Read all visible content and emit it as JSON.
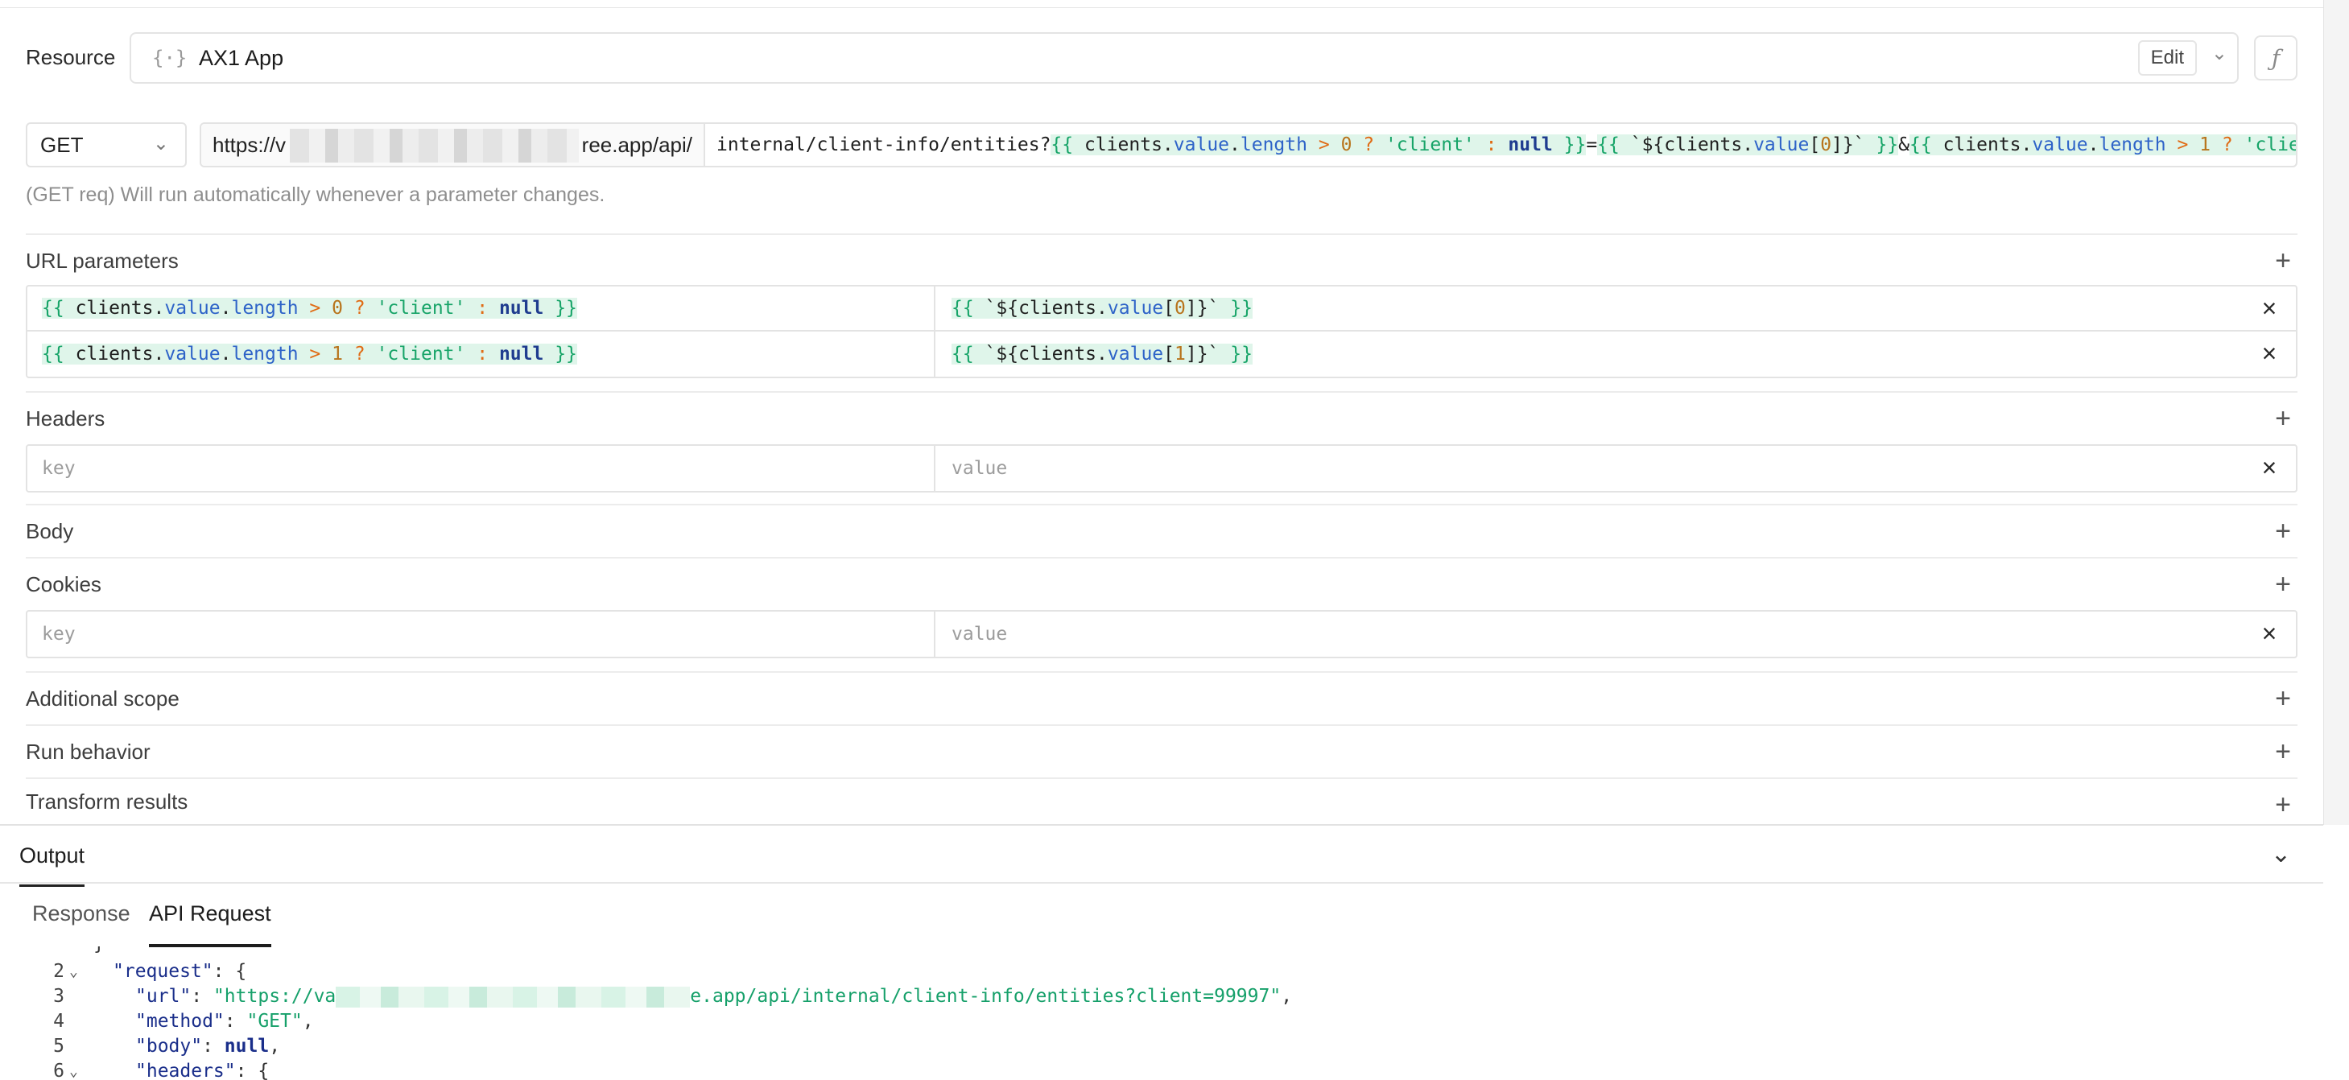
{
  "resource": {
    "label": "Resource",
    "icon": "braces-icon",
    "name": "AX1 App",
    "edit_label": "Edit",
    "fx_label": "ƒ"
  },
  "request": {
    "method": "GET",
    "base_url_prefix": "https://v",
    "base_url_suffix": "ree.app/api/",
    "hint": "(GET req) Will run automatically whenever a parameter changes."
  },
  "sections": {
    "url_parameters": "URL parameters",
    "headers": "Headers",
    "body": "Body",
    "cookies": "Cookies",
    "additional_scope": "Additional scope",
    "run_behavior": "Run behavior",
    "transform_results": "Transform results"
  },
  "placeholders": {
    "key": "key",
    "value": "value"
  },
  "output": {
    "title": "Output",
    "tabs": [
      "Response",
      "API Request"
    ],
    "active_tab": "API Request"
  },
  "code": {
    "line_numbers": [
      "2",
      "3",
      "4",
      "5",
      "6"
    ],
    "request_key": "\"request\"",
    "url_key": "\"url\"",
    "url_prefix": "\"https://va",
    "url_suffix": "e.app/api/internal/client-info/entities?client=99997\"",
    "method_key": "\"method\"",
    "method_val": "\"GET\"",
    "body_key": "\"body\"",
    "body_val": "null",
    "headers_key": "\"headers\""
  },
  "colors": {
    "template_green": "#17a468",
    "property_blue": "#2e63c8",
    "keyword_navy": "#1f3c8f",
    "number_orange": "#b8741c"
  }
}
